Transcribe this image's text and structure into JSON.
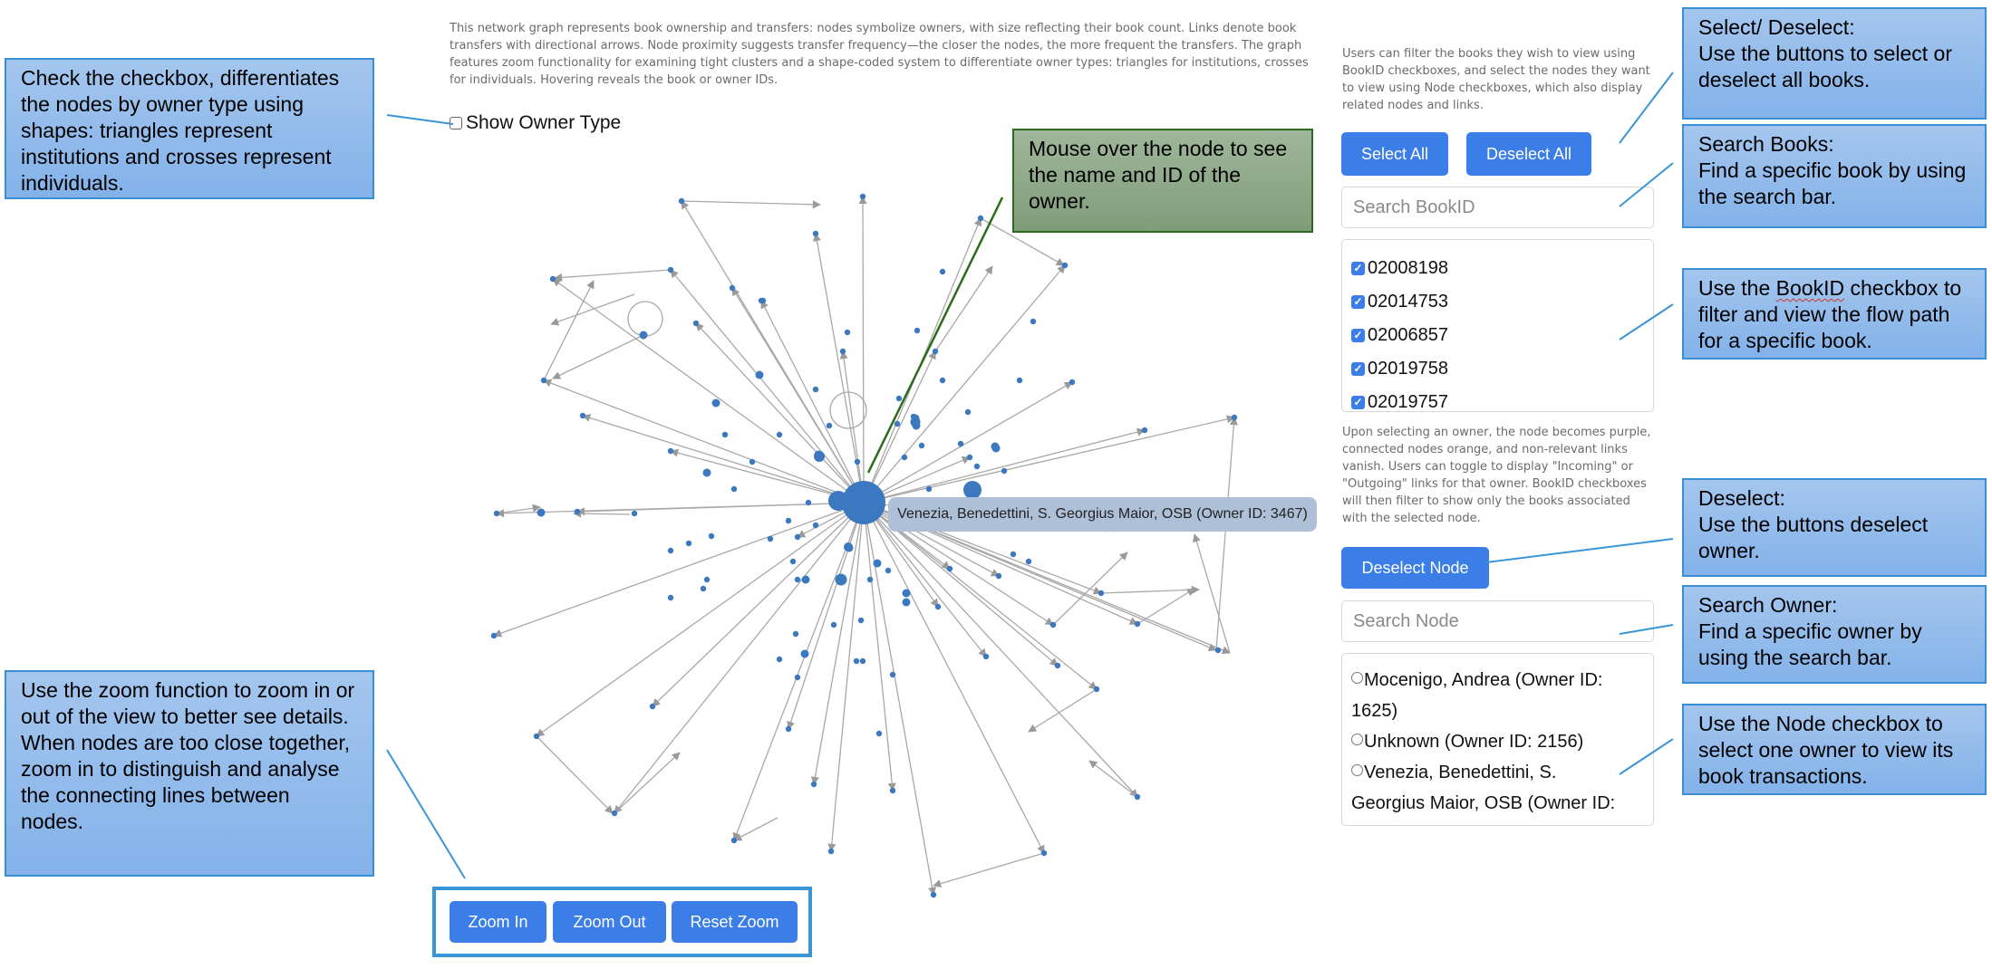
{
  "description": "This network graph represents book ownership and transfers: nodes symbolize owners, with size reflecting their book count. Links denote book transfers with directional arrows. Node proximity suggests transfer frequency—the closer the nodes, the more frequent the transfers. The graph features zoom functionality for examining tight clusters and a shape-coded system to differentiate owner types: triangles for institutions, crosses for individuals. Hovering reveals the book or owner IDs.",
  "owner_type_label": "Show Owner Type",
  "filter_help": "Users can filter the books they wish to view using BookID checkboxes, and select the nodes they want to view using Node checkboxes, which also display related nodes and links.",
  "buttons": {
    "select_all": "Select All",
    "deselect_all": "Deselect All",
    "deselect_node": "Deselect Node",
    "zoom_in": "Zoom In",
    "zoom_out": "Zoom Out",
    "reset_zoom": "Reset Zoom"
  },
  "search_book_placeholder": "Search BookID",
  "search_node_placeholder": "Search Node",
  "book_ids": [
    "02008198",
    "02014753",
    "02006857",
    "02019758",
    "02019757"
  ],
  "owner_help": "Upon selecting an owner, the node becomes purple, connected nodes orange, and non-relevant links vanish. Users can toggle to display \"Incoming\" or \"Outgoing\" links for that owner. BookID checkboxes will then filter to show only the books associated with the selected node.",
  "owners": [
    "Mocenigo, Andrea (Owner ID: 1625)",
    "Unknown (Owner ID: 2156)",
    "Venezia, Benedettini, S. Georgius Maior, OSB (Owner ID: 3467)"
  ],
  "tooltip": "Venezia, Benedettini, S. Georgius Maior, OSB (Owner ID: 3467)",
  "callouts": {
    "owner_type": "Check the checkbox, differentiates the nodes by owner type using shapes: triangles represent institutions and crosses represent individuals.",
    "mouse_over": "Mouse over the node to see the name and ID of the owner.",
    "zoom": "Use the zoom function to zoom in or out of the view to better see details.\nWhen nodes are too close together, zoom in to distinguish and analyse the connecting lines between nodes.",
    "select_deselect": "Select/ Deselect:\nUse the buttons to select or deselect all books.",
    "search_books": "Search Books:\nFind a specific book by using the search bar.",
    "bookid_checkbox_pre": "Use the ",
    "bookid_checkbox_word": "BookID",
    "bookid_checkbox_post": " checkbox to filter and view the flow path for a specific book.",
    "deselect": "Deselect:\nUse the buttons deselect owner.",
    "search_owner": "Search Owner:\nFind a specific owner by using the search bar.",
    "node_checkbox": "Use the Node checkbox to select one owner to view its book transactions."
  },
  "colors": {
    "node": "#3b78c0",
    "link": "#a8a8a8",
    "button": "#3b7ee8",
    "callout_blue": "#8fb9ea",
    "callout_green": "#8ea889"
  }
}
